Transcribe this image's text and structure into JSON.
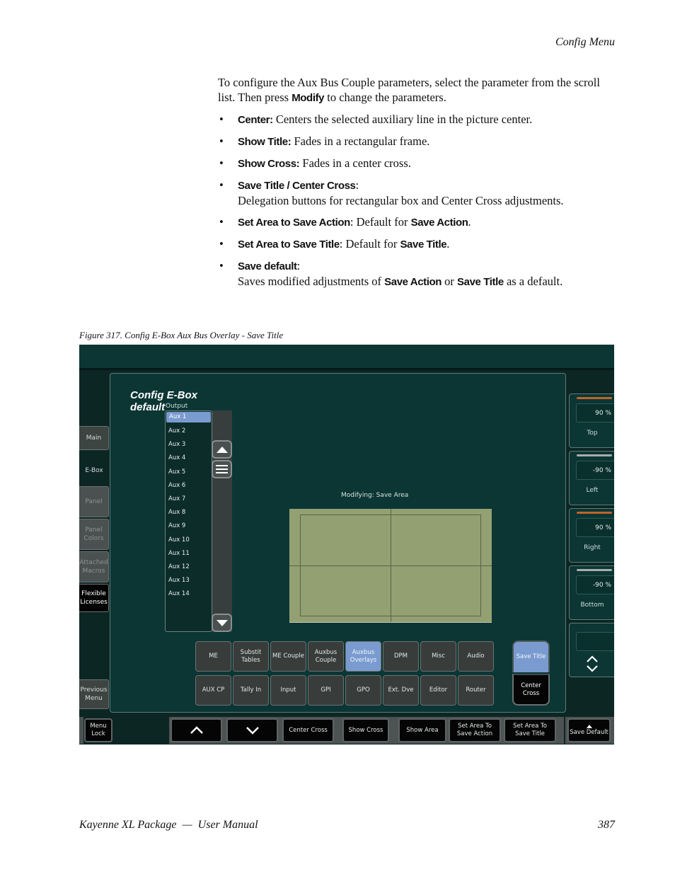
{
  "page": {
    "running_header": "Config Menu",
    "footer_title": "Kayenne XL Package  —  User Manual",
    "page_number": "387"
  },
  "intro": {
    "text_before": "To configure the Aux Bus Couple parameters, select the parameter from the scroll list. Then press ",
    "keyword": "Modify",
    "text_after": " to change the parameters."
  },
  "bullets": [
    {
      "term": "Center:",
      "desc": " Centers the selected auxiliary line in the picture center."
    },
    {
      "term": "Show Title:",
      "desc": " Fades in a rectangular frame."
    },
    {
      "term": "Show Cross:",
      "desc": " Fades in a center cross."
    },
    {
      "term": "Save Title / Center Cross",
      "sep": ":",
      "desc": "Delegation buttons for rectangular box and Center Cross adjustments."
    },
    {
      "term": "Set Area to Save Action",
      "sep": ": Default for ",
      "ref": "Save Action",
      "end": "."
    },
    {
      "term": "Set Area to Save Title",
      "sep": ": Default for ",
      "ref": "Save Title",
      "end": "."
    },
    {
      "term": "Save default",
      "sep": ":",
      "desc_before": "Saves modified adjustments of ",
      "ref1": "Save Action",
      "mid": " or ",
      "ref2": "Save Title",
      "desc_after": " as a default."
    }
  ],
  "figure": {
    "caption": "Figure 317.  Config E-Box Aux Bus Overlay - Save Title"
  },
  "ui": {
    "panel_title_line1": "Config E-Box",
    "panel_title_line2": "default",
    "nav": [
      {
        "label": "Main"
      },
      {
        "label": "E-Box"
      },
      {
        "label": "Panel"
      },
      {
        "label": "Panel Colors"
      },
      {
        "label": "Attached Macros"
      },
      {
        "label": "Flexible Licenses"
      },
      {
        "label": "Previous Menu"
      }
    ],
    "output_label": "Output",
    "output_list": [
      "Aux 1",
      "Aux 2",
      "Aux 3",
      "Aux 4",
      "Aux 5",
      "Aux 6",
      "Aux 7",
      "Aux 8",
      "Aux 9",
      "Aux 10",
      "Aux 11",
      "Aux 12",
      "Aux 13",
      "Aux 14"
    ],
    "selected_output": "Aux 1",
    "modifying_label": "Modifying: Save Area",
    "grid_row1": [
      "ME",
      "Substit Tables",
      "ME Couple",
      "Auxbus Couple",
      "Auxbus Overlays",
      "DPM",
      "Misc",
      "Audio"
    ],
    "grid_row2": [
      "AUX CP",
      "Tally In",
      "Input",
      "GPI",
      "GPO",
      "Ext. Dve",
      "Editor",
      "Router"
    ],
    "selected_category": "Auxbus Overlays",
    "delegation": {
      "save_title": "Save Title",
      "center_cross": "Center Cross"
    },
    "params": [
      {
        "value": "90 %",
        "label": "Top",
        "accent": "#c0652a"
      },
      {
        "value": "-90 %",
        "label": "Left",
        "accent": "#a9aeac"
      },
      {
        "value": "90 %",
        "label": "Right",
        "accent": "#c0652a"
      },
      {
        "value": "-90 %",
        "label": "Bottom",
        "accent": "#a9aeac"
      },
      {
        "value": "",
        "label": ""
      }
    ],
    "bottom": {
      "menu_lock": "Menu Lock",
      "center_cross": "Center Cross",
      "show_cross": "Show Cross",
      "show_area": "Show Area",
      "set_area_save_action": "Set Area To Save Action",
      "set_area_save_title": "Set Area To Save Title",
      "save_default": "Save Default"
    },
    "colors": {
      "panel_bg": "#0b3634",
      "selected_blue": "#7a9bd0",
      "preview_green": "#93a071",
      "orange_bar": "#c0652a"
    }
  }
}
